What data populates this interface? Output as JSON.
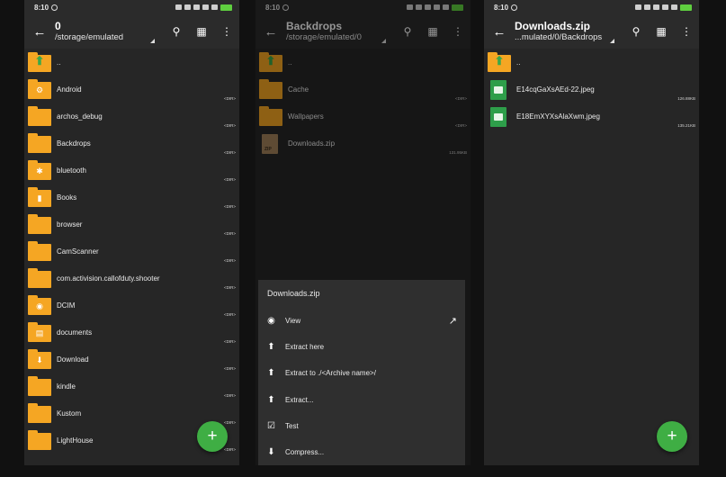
{
  "status": {
    "time": "8:10"
  },
  "panel1": {
    "title": "0",
    "subtitle": "/storage/emulated",
    "up_label": "..",
    "rows": [
      {
        "name": "Android",
        "meta": "<DIR>",
        "glyph": "⚙"
      },
      {
        "name": "archos_debug",
        "meta": "<DIR>",
        "glyph": ""
      },
      {
        "name": "Backdrops",
        "meta": "<DIR>",
        "glyph": ""
      },
      {
        "name": "bluetooth",
        "meta": "<DIR>",
        "glyph": "✱"
      },
      {
        "name": "Books",
        "meta": "<DIR>",
        "glyph": "▮"
      },
      {
        "name": "browser",
        "meta": "<DIR>",
        "glyph": ""
      },
      {
        "name": "CamScanner",
        "meta": "<DIR>",
        "glyph": ""
      },
      {
        "name": "com.activision.callofduty.shooter",
        "meta": "<DIR>",
        "glyph": ""
      },
      {
        "name": "DCIM",
        "meta": "<DIR>",
        "glyph": "◉"
      },
      {
        "name": "documents",
        "meta": "<DIR>",
        "glyph": "▤"
      },
      {
        "name": "Download",
        "meta": "<DIR>",
        "glyph": "⬇"
      },
      {
        "name": "kindle",
        "meta": "<DIR>",
        "glyph": ""
      },
      {
        "name": "Kustom",
        "meta": "<DIR>",
        "glyph": ""
      },
      {
        "name": "LightHouse",
        "meta": "<DIR>",
        "glyph": ""
      }
    ],
    "fab_label": "+"
  },
  "panel2": {
    "title": "Backdrops",
    "subtitle": "/storage/emulated/0",
    "up_label": "..",
    "rows": [
      {
        "name": "Cache",
        "meta": "<DIR>"
      },
      {
        "name": "Wallpapers",
        "meta": "<DIR>"
      },
      {
        "name": "Downloads.zip",
        "meta": "131.95KB",
        "icon_text": "ZIP"
      }
    ],
    "sheet": {
      "title": "Downloads.zip",
      "items": [
        {
          "label": "View",
          "icon": "eye-icon",
          "glyph": "◉",
          "extra": "↗"
        },
        {
          "label": "Extract here",
          "icon": "upload-icon",
          "glyph": "⬆"
        },
        {
          "label": "Extract to ./<Archive name>/",
          "icon": "upload-icon",
          "glyph": "⬆"
        },
        {
          "label": "Extract...",
          "icon": "upload-icon",
          "glyph": "⬆"
        },
        {
          "label": "Test",
          "icon": "check-box-icon",
          "glyph": "☑"
        },
        {
          "label": "Compress...",
          "icon": "download-icon",
          "glyph": "⬇"
        }
      ]
    }
  },
  "panel3": {
    "title": "Downloads.zip",
    "subtitle": "...mulated/0/Backdrops",
    "up_label": "..",
    "rows": [
      {
        "name": "E14cqGaXsAEd-22.jpeg",
        "meta": "126.88KB"
      },
      {
        "name": "E18EmXYXsAlaXwm.jpeg",
        "meta": "135.21KB"
      }
    ],
    "fab_label": "+"
  },
  "colors": {
    "folder": "#f5a623",
    "fab": "#3fae44",
    "background": "#262626",
    "toolbar": "#2b2b2b",
    "image_file": "#2e9e4a"
  }
}
